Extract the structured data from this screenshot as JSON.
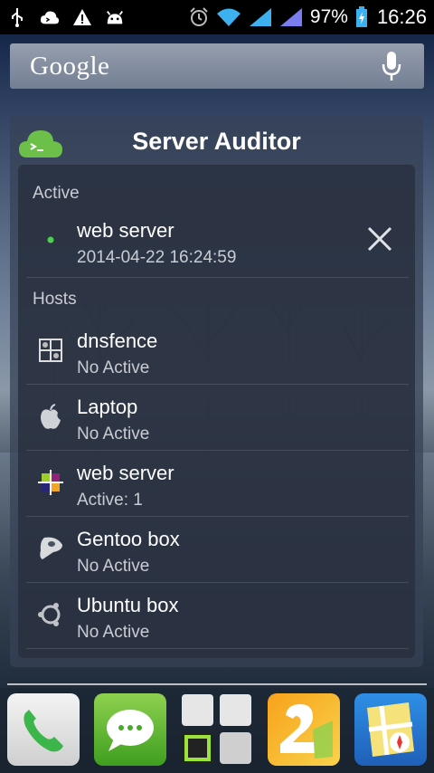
{
  "status_bar": {
    "left_icons": [
      "usb-icon",
      "cloud-notification-icon",
      "warning-icon",
      "android-icon"
    ],
    "battery_percent": "97%",
    "time": "16:26"
  },
  "search": {
    "logo_text": "Google"
  },
  "widget": {
    "title": "Server Auditor",
    "active_label": "Active",
    "active": [
      {
        "name": "web server",
        "detail": "2014-04-22 16:24:59",
        "icon": "green-dot-icon"
      }
    ],
    "hosts_label": "Hosts",
    "hosts": [
      {
        "name": "dnsfence",
        "detail": "No Active",
        "icon": "bsd-icon"
      },
      {
        "name": "Laptop",
        "detail": "No Active",
        "icon": "apple-icon"
      },
      {
        "name": "web server",
        "detail": "Active: 1",
        "icon": "centos-icon"
      },
      {
        "name": "Gentoo box",
        "detail": "No Active",
        "icon": "gentoo-icon"
      },
      {
        "name": "Ubuntu box",
        "detail": "No Active",
        "icon": "ubuntu-icon"
      }
    ]
  },
  "dock": {
    "apps": [
      "phone",
      "messaging",
      "app-drawer",
      "app-2",
      "maps"
    ]
  }
}
